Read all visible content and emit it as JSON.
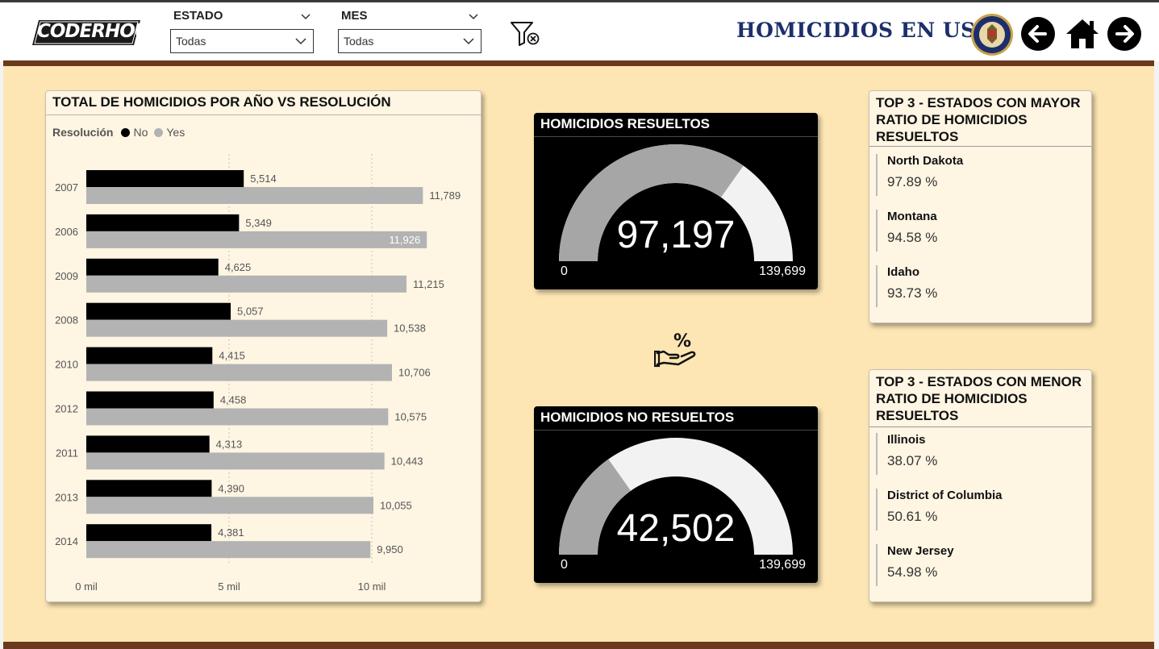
{
  "header": {
    "logo_text": "CODERHOUSE",
    "title": "HOMICIDIOS EN USA",
    "slicers": [
      {
        "label": "ESTADO",
        "value": "Todas"
      },
      {
        "label": "MES",
        "value": "Todas"
      }
    ]
  },
  "icons": {
    "logo": "coderhouse-logo",
    "filter_clear": "clear-filter-icon",
    "seal": "doj-seal-icon",
    "back": "arrow-left-icon",
    "home": "home-icon",
    "forward": "arrow-right-icon",
    "percent_hand": "percent-hand-icon"
  },
  "colors": {
    "brand_brown": "#6b3a1e",
    "canvas_bg": "#fde6b4",
    "card_bg": "#fef5e3",
    "series_no": "#000000",
    "series_yes": "#b3b3b3",
    "title_navy": "#1d2f6b"
  },
  "chart_data": {
    "type": "bar",
    "orientation": "horizontal",
    "title": "TOTAL DE HOMICIDIOS POR AÑO VS RESOLUCIÓN",
    "legend_title": "Resolución",
    "legend_position": "top-left",
    "categories": [
      "2007",
      "2006",
      "2009",
      "2008",
      "2010",
      "2012",
      "2011",
      "2013",
      "2014"
    ],
    "series": [
      {
        "name": "No",
        "color": "#000000",
        "values": [
          5514,
          5349,
          4625,
          5057,
          4415,
          4458,
          4313,
          4390,
          4381
        ],
        "labels": [
          "5,514",
          "5,349",
          "4,625",
          "5,057",
          "4,415",
          "4,458",
          "4,313",
          "4,390",
          "4,381"
        ]
      },
      {
        "name": "Yes",
        "color": "#b3b3b3",
        "values": [
          11789,
          11926,
          11215,
          10538,
          10706,
          10575,
          10443,
          10055,
          9950
        ],
        "labels": [
          "11,789",
          "11,926",
          "11,215",
          "10,538",
          "10,706",
          "10,575",
          "10,443",
          "10,055",
          "9,950"
        ]
      }
    ],
    "x_ticks": [
      {
        "value": 0,
        "label": "0 mil"
      },
      {
        "value": 5000,
        "label": "5 mil"
      },
      {
        "value": 10000,
        "label": "10 mil"
      }
    ],
    "xlim": [
      0,
      12000
    ],
    "grid": true
  },
  "gauges": [
    {
      "title": "HOMICIDIOS RESUELTOS",
      "value": 97197,
      "value_label": "97,197",
      "min": 0,
      "min_label": "0",
      "max": 139699,
      "max_label": "139,699"
    },
    {
      "title": "HOMICIDIOS NO RESUELTOS",
      "value": 42502,
      "value_label": "42,502",
      "min": 0,
      "min_label": "0",
      "max": 139699,
      "max_label": "139,699"
    }
  ],
  "top_mayor": {
    "title": "TOP 3 - ESTADOS CON MAYOR RATIO DE HOMICIDIOS RESUELTOS",
    "items": [
      {
        "name": "North Dakota",
        "value": "97.89 %"
      },
      {
        "name": "Montana",
        "value": "94.58 %"
      },
      {
        "name": "Idaho",
        "value": "93.73 %"
      }
    ]
  },
  "top_menor": {
    "title": "TOP 3 - ESTADOS CON MENOR RATIO DE HOMICIDIOS RESUELTOS",
    "items": [
      {
        "name": "Illinois",
        "value": "38.07 %"
      },
      {
        "name": "District of Columbia",
        "value": "50.61 %"
      },
      {
        "name": "New Jersey",
        "value": "54.98 %"
      }
    ]
  }
}
